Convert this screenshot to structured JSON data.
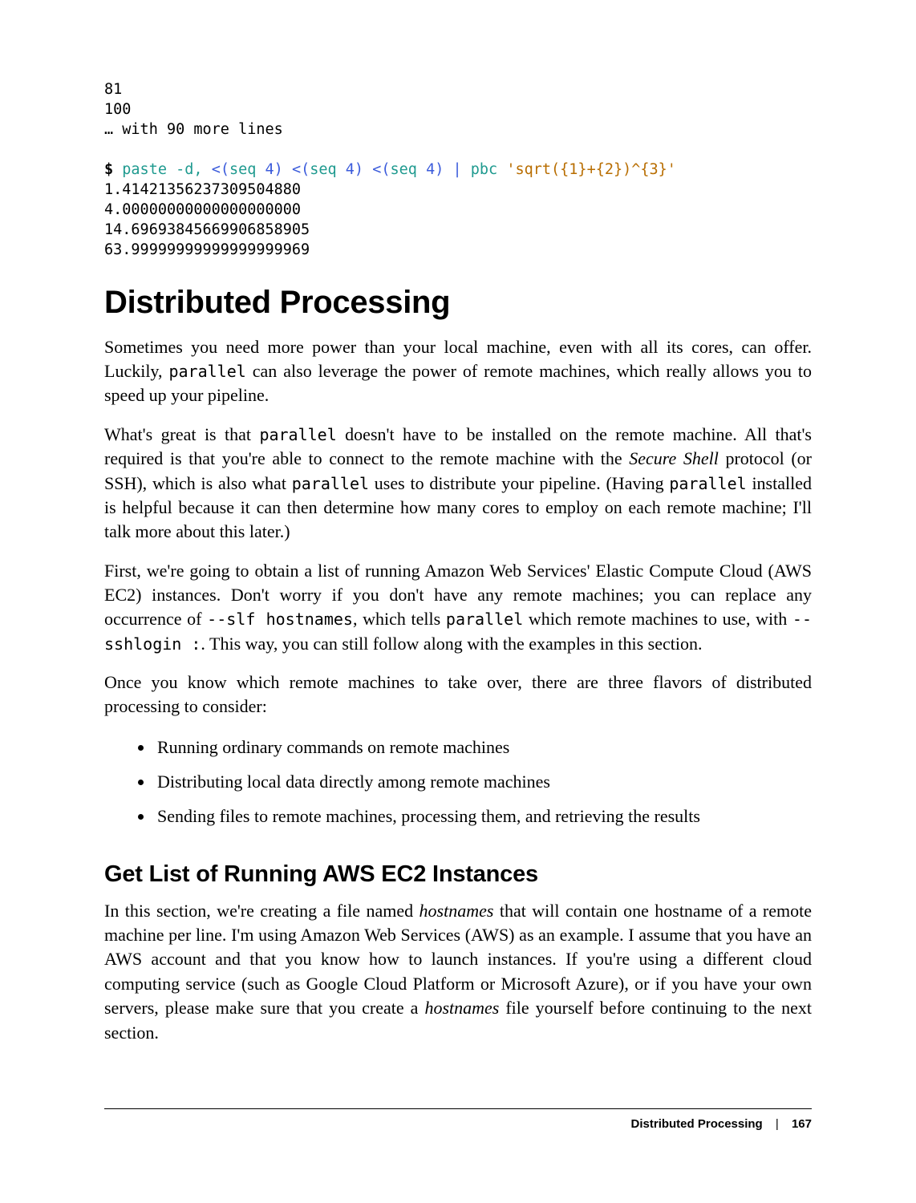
{
  "code": {
    "pre_lines": [
      "81",
      "100",
      "… with 90 more lines"
    ],
    "prompt": "$",
    "cmd_tokens": {
      "paste": "paste",
      "opt_d": "-d,",
      "lt": "<(",
      "seq": "seq",
      "four_close": "4)",
      "pipe": "|",
      "pbc": "pbc",
      "expr": "'sqrt({1}+{2})^{3}'"
    },
    "out_lines": [
      "1.41421356237309504880",
      "4.00000000000000000000",
      "14.69693845669906858905",
      "63.99999999999999999969"
    ]
  },
  "osspec": {
    "title": "Distributed Processing",
    "p1_a": "Sometimes you need more power than your local machine, even with all its cores, can offer. Luckily, ",
    "p1_code1": "parallel",
    "p1_b": " can also leverage the power of remote machines, which really allows you to speed up your pipeline.",
    "p2_a": "What's great is that ",
    "p2_code1": "parallel",
    "p2_b": " doesn't have to be installed on the remote machine. All that's required is that you're able to connect to the remote machine with the ",
    "p2_em1": "Secure Shell",
    "p2_c": " protocol (or SSH), which is also what ",
    "p2_code2": "parallel",
    "p2_d": " uses to distribute your pipeline. (Having ",
    "p2_code3": "parallel",
    "p2_e": " installed is helpful because it can then determine how many cores to employ on each remote machine; I'll talk more about this later.)",
    "p3_a": "First, we're going to obtain a list of running Amazon Web Services' Elastic Compute Cloud (AWS EC2) instances. Don't worry if you don't have any remote machines; you can replace any occurrence of ",
    "p3_code1": "--slf hostnames",
    "p3_b": ", which tells ",
    "p3_code2": "parallel",
    "p3_c": " which remote machines to use, with ",
    "p3_code3": "--sshlogin :",
    "p3_d": ". This way, you can still follow along with the examples in this section.",
    "p4": "Once you know which remote machines to take over, there are three flavors of distributed processing to consider:",
    "bullets": [
      "Running ordinary commands on remote machines",
      "Distributing local data directly among remote machines",
      "Sending files to remote machines, processing them, and retrieving the results"
    ],
    "subsection": "Get List of Running AWS EC2 Instances",
    "p5_a": "In this section, we're creating a file named ",
    "p5_em1": "hostnames",
    "p5_b": " that will contain one hostname of a remote machine per line. I'm using Amazon Web Services (AWS) as an example. I assume that you have an AWS account and that you know how to launch instances. If you're using a different cloud computing service (such as Google Cloud Platform or Microsoft Azure), or if you have your own servers, please make sure that you create a ",
    "p5_em2": "hostnames",
    "p5_c": " file yourself before continuing to the next section."
  },
  "footer": {
    "title": "Distributed Processing",
    "sep": "|",
    "page": "167"
  }
}
